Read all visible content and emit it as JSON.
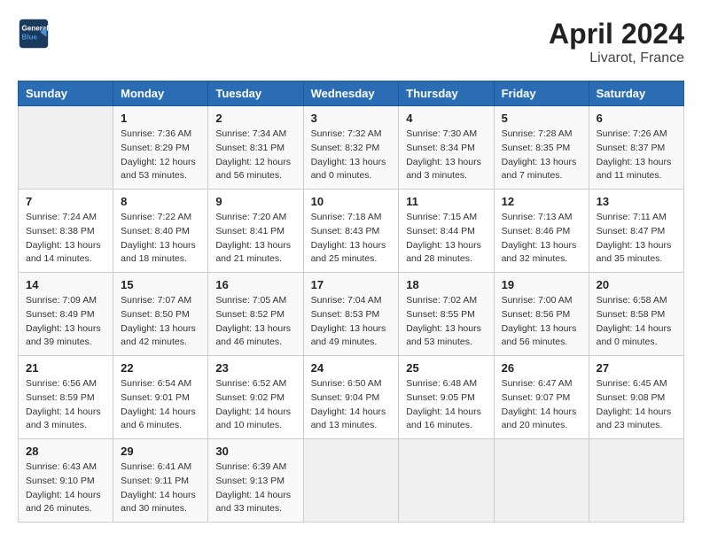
{
  "header": {
    "logo_line1": "General",
    "logo_line2": "Blue",
    "title": "April 2024",
    "subtitle": "Livarot, France"
  },
  "weekdays": [
    "Sunday",
    "Monday",
    "Tuesday",
    "Wednesday",
    "Thursday",
    "Friday",
    "Saturday"
  ],
  "weeks": [
    [
      {
        "day": "",
        "sunrise": "",
        "sunset": "",
        "daylight": ""
      },
      {
        "day": "1",
        "sunrise": "Sunrise: 7:36 AM",
        "sunset": "Sunset: 8:29 PM",
        "daylight": "Daylight: 12 hours and 53 minutes."
      },
      {
        "day": "2",
        "sunrise": "Sunrise: 7:34 AM",
        "sunset": "Sunset: 8:31 PM",
        "daylight": "Daylight: 12 hours and 56 minutes."
      },
      {
        "day": "3",
        "sunrise": "Sunrise: 7:32 AM",
        "sunset": "Sunset: 8:32 PM",
        "daylight": "Daylight: 13 hours and 0 minutes."
      },
      {
        "day": "4",
        "sunrise": "Sunrise: 7:30 AM",
        "sunset": "Sunset: 8:34 PM",
        "daylight": "Daylight: 13 hours and 3 minutes."
      },
      {
        "day": "5",
        "sunrise": "Sunrise: 7:28 AM",
        "sunset": "Sunset: 8:35 PM",
        "daylight": "Daylight: 13 hours and 7 minutes."
      },
      {
        "day": "6",
        "sunrise": "Sunrise: 7:26 AM",
        "sunset": "Sunset: 8:37 PM",
        "daylight": "Daylight: 13 hours and 11 minutes."
      }
    ],
    [
      {
        "day": "7",
        "sunrise": "Sunrise: 7:24 AM",
        "sunset": "Sunset: 8:38 PM",
        "daylight": "Daylight: 13 hours and 14 minutes."
      },
      {
        "day": "8",
        "sunrise": "Sunrise: 7:22 AM",
        "sunset": "Sunset: 8:40 PM",
        "daylight": "Daylight: 13 hours and 18 minutes."
      },
      {
        "day": "9",
        "sunrise": "Sunrise: 7:20 AM",
        "sunset": "Sunset: 8:41 PM",
        "daylight": "Daylight: 13 hours and 21 minutes."
      },
      {
        "day": "10",
        "sunrise": "Sunrise: 7:18 AM",
        "sunset": "Sunset: 8:43 PM",
        "daylight": "Daylight: 13 hours and 25 minutes."
      },
      {
        "day": "11",
        "sunrise": "Sunrise: 7:15 AM",
        "sunset": "Sunset: 8:44 PM",
        "daylight": "Daylight: 13 hours and 28 minutes."
      },
      {
        "day": "12",
        "sunrise": "Sunrise: 7:13 AM",
        "sunset": "Sunset: 8:46 PM",
        "daylight": "Daylight: 13 hours and 32 minutes."
      },
      {
        "day": "13",
        "sunrise": "Sunrise: 7:11 AM",
        "sunset": "Sunset: 8:47 PM",
        "daylight": "Daylight: 13 hours and 35 minutes."
      }
    ],
    [
      {
        "day": "14",
        "sunrise": "Sunrise: 7:09 AM",
        "sunset": "Sunset: 8:49 PM",
        "daylight": "Daylight: 13 hours and 39 minutes."
      },
      {
        "day": "15",
        "sunrise": "Sunrise: 7:07 AM",
        "sunset": "Sunset: 8:50 PM",
        "daylight": "Daylight: 13 hours and 42 minutes."
      },
      {
        "day": "16",
        "sunrise": "Sunrise: 7:05 AM",
        "sunset": "Sunset: 8:52 PM",
        "daylight": "Daylight: 13 hours and 46 minutes."
      },
      {
        "day": "17",
        "sunrise": "Sunrise: 7:04 AM",
        "sunset": "Sunset: 8:53 PM",
        "daylight": "Daylight: 13 hours and 49 minutes."
      },
      {
        "day": "18",
        "sunrise": "Sunrise: 7:02 AM",
        "sunset": "Sunset: 8:55 PM",
        "daylight": "Daylight: 13 hours and 53 minutes."
      },
      {
        "day": "19",
        "sunrise": "Sunrise: 7:00 AM",
        "sunset": "Sunset: 8:56 PM",
        "daylight": "Daylight: 13 hours and 56 minutes."
      },
      {
        "day": "20",
        "sunrise": "Sunrise: 6:58 AM",
        "sunset": "Sunset: 8:58 PM",
        "daylight": "Daylight: 14 hours and 0 minutes."
      }
    ],
    [
      {
        "day": "21",
        "sunrise": "Sunrise: 6:56 AM",
        "sunset": "Sunset: 8:59 PM",
        "daylight": "Daylight: 14 hours and 3 minutes."
      },
      {
        "day": "22",
        "sunrise": "Sunrise: 6:54 AM",
        "sunset": "Sunset: 9:01 PM",
        "daylight": "Daylight: 14 hours and 6 minutes."
      },
      {
        "day": "23",
        "sunrise": "Sunrise: 6:52 AM",
        "sunset": "Sunset: 9:02 PM",
        "daylight": "Daylight: 14 hours and 10 minutes."
      },
      {
        "day": "24",
        "sunrise": "Sunrise: 6:50 AM",
        "sunset": "Sunset: 9:04 PM",
        "daylight": "Daylight: 14 hours and 13 minutes."
      },
      {
        "day": "25",
        "sunrise": "Sunrise: 6:48 AM",
        "sunset": "Sunset: 9:05 PM",
        "daylight": "Daylight: 14 hours and 16 minutes."
      },
      {
        "day": "26",
        "sunrise": "Sunrise: 6:47 AM",
        "sunset": "Sunset: 9:07 PM",
        "daylight": "Daylight: 14 hours and 20 minutes."
      },
      {
        "day": "27",
        "sunrise": "Sunrise: 6:45 AM",
        "sunset": "Sunset: 9:08 PM",
        "daylight": "Daylight: 14 hours and 23 minutes."
      }
    ],
    [
      {
        "day": "28",
        "sunrise": "Sunrise: 6:43 AM",
        "sunset": "Sunset: 9:10 PM",
        "daylight": "Daylight: 14 hours and 26 minutes."
      },
      {
        "day": "29",
        "sunrise": "Sunrise: 6:41 AM",
        "sunset": "Sunset: 9:11 PM",
        "daylight": "Daylight: 14 hours and 30 minutes."
      },
      {
        "day": "30",
        "sunrise": "Sunrise: 6:39 AM",
        "sunset": "Sunset: 9:13 PM",
        "daylight": "Daylight: 14 hours and 33 minutes."
      },
      {
        "day": "",
        "sunrise": "",
        "sunset": "",
        "daylight": ""
      },
      {
        "day": "",
        "sunrise": "",
        "sunset": "",
        "daylight": ""
      },
      {
        "day": "",
        "sunrise": "",
        "sunset": "",
        "daylight": ""
      },
      {
        "day": "",
        "sunrise": "",
        "sunset": "",
        "daylight": ""
      }
    ]
  ]
}
